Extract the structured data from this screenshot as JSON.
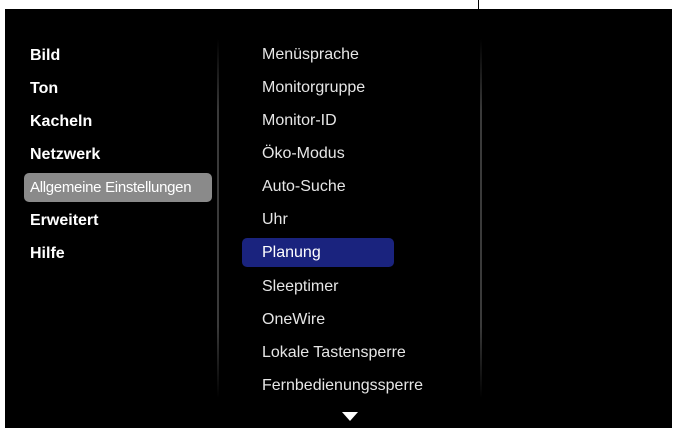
{
  "left_menu": {
    "items": [
      {
        "label": "Bild"
      },
      {
        "label": "Ton"
      },
      {
        "label": "Kacheln"
      },
      {
        "label": "Netzwerk"
      },
      {
        "label": "Allgemeine Einstellungen"
      },
      {
        "label": "Erweitert"
      },
      {
        "label": "Hilfe"
      }
    ],
    "selected": "Allgemeine Einstellungen"
  },
  "sub_menu": {
    "items": [
      {
        "label": "Menüsprache"
      },
      {
        "label": "Monitorgruppe"
      },
      {
        "label": "Monitor-ID"
      },
      {
        "label": "Öko-Modus"
      },
      {
        "label": "Auto-Suche"
      },
      {
        "label": "Uhr"
      },
      {
        "label": "Planung"
      },
      {
        "label": "Sleeptimer"
      },
      {
        "label": "OneWire"
      },
      {
        "label": "Lokale Tastensperre"
      },
      {
        "label": "Fernbedienungssperre"
      }
    ],
    "selected": "Planung",
    "more_below_icon": "chevron-down-icon"
  },
  "colors": {
    "background": "#000000",
    "left_highlight": "#8a8a8a",
    "sub_highlight": "#1a237e",
    "text": "#ffffff"
  }
}
